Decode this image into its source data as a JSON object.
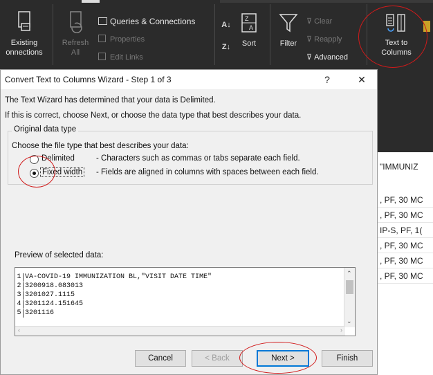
{
  "ribbon": {
    "existing_connections": "Existing\nonnections",
    "refresh_all": "Refresh\nAll",
    "queries_connections": "Queries & Connections",
    "properties": "Properties",
    "edit_links": "Edit Links",
    "sort": "Sort",
    "filter": "Filter",
    "clear": "Clear",
    "reapply": "Reapply",
    "advanced": "Advanced",
    "text_to_columns": "Text to\nColumns"
  },
  "sheet": {
    "cells": [
      "\"IMMUNIZ",
      ", PF, 30 MC",
      ", PF, 30 MC",
      "IP-S, PF, 1(",
      ", PF, 30 MC",
      ", PF, 30 MC",
      ", PF, 30 MC"
    ]
  },
  "dialog": {
    "title": "Convert Text to Columns Wizard - Step 1 of 3",
    "help_label": "?",
    "close_label": "✕",
    "intro_1": "The Text Wizard has determined that your data is Delimited.",
    "intro_2": "If this is correct, choose Next, or choose the data type that best describes your data.",
    "group_label": "Original data type",
    "choose_label": "Choose the file type that best describes your data:",
    "delimited_label": "Delimited",
    "delimited_desc": "- Characters such as commas or tabs separate each field.",
    "fixed_label": "Fixed width",
    "fixed_desc": "- Fields are aligned in columns with spaces between each field.",
    "selected_type": "fixed_width",
    "preview_label": "Preview of selected data:",
    "preview_lines": [
      {
        "num": "1",
        "text": "VA-COVID-19 IMMUNIZATION BL,\"VISIT DATE TIME\""
      },
      {
        "num": "2",
        "text": "3200918.083013"
      },
      {
        "num": "3",
        "text": "3201027.1115"
      },
      {
        "num": "4",
        "text": "3201124.151645"
      },
      {
        "num": "5",
        "text": "3201116"
      }
    ],
    "cancel_label": "Cancel",
    "back_label": "< Back",
    "next_label": "Next >",
    "finish_label": "Finish"
  },
  "colors": {
    "ribbon_bg": "#2b2b2b",
    "dialog_bg": "#f0f0f0",
    "annotation_red": "#d11a1a",
    "focus_blue": "#0078d7"
  }
}
